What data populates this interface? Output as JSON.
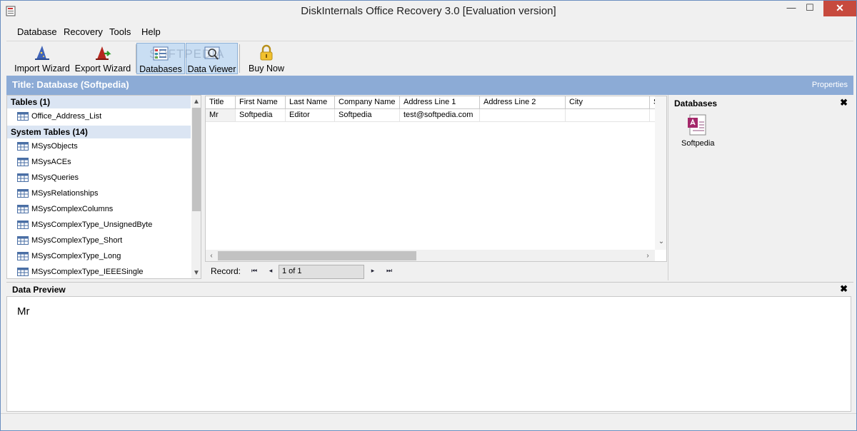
{
  "window": {
    "title": "DiskInternals Office Recovery 3.0 [Evaluation version]",
    "minimize": "—",
    "maximize": "☐",
    "close": "✕"
  },
  "menu": {
    "items": [
      "Database",
      "Recovery",
      "Tools",
      "Help"
    ]
  },
  "toolbar": {
    "import_wizard": "Import Wizard",
    "export_wizard": "Export Wizard",
    "databases": "Databases",
    "data_viewer": "Data Viewer",
    "buy_now": "Buy Now",
    "watermark": "SOFTPEDIA"
  },
  "header": {
    "title": "Title: Database (Softpedia)",
    "properties": "Properties"
  },
  "tree": {
    "tables_group": "Tables (1)",
    "tables": [
      "Office_Address_List"
    ],
    "system_group": "System Tables (14)",
    "system_tables": [
      "MSysObjects",
      "MSysACEs",
      "MSysQueries",
      "MSysRelationships",
      "MSysComplexColumns",
      "MSysComplexType_UnsignedByte",
      "MSysComplexType_Short",
      "MSysComplexType_Long",
      "MSysComplexType_IEEESingle"
    ]
  },
  "grid": {
    "columns": [
      "Title",
      "First Name",
      "Last Name",
      "Company Name",
      "Address Line 1",
      "Address Line 2",
      "City",
      "Sta"
    ],
    "rows": [
      [
        "Mr",
        "Softpedia",
        "Editor",
        "Softpedia",
        "test@softpedia.com",
        "",
        "",
        ""
      ]
    ]
  },
  "record_nav": {
    "label": "Record:",
    "value": "1 of 1",
    "first": "⏮",
    "prev": "◂",
    "next": "▸",
    "last": "⏭"
  },
  "databases_panel": {
    "title": "Databases",
    "close": "✖",
    "item": "Softpedia"
  },
  "preview": {
    "title": "Data Preview",
    "close": "✖",
    "text": "Mr"
  },
  "colors": {
    "accent": "#8cabd6",
    "group_bg": "#dbe5f3",
    "close_red": "#c74a3e"
  }
}
